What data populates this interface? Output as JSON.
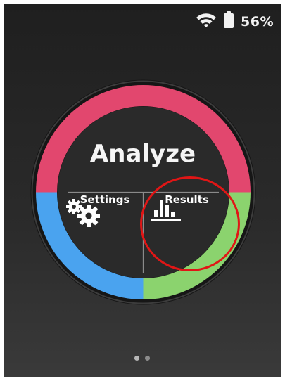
{
  "status_bar": {
    "wifi_icon": "wifi-icon",
    "battery_icon": "battery-icon",
    "battery_percent": "56%"
  },
  "dial": {
    "colors": {
      "top": "#e2476e",
      "left": "#4aa3ef",
      "right": "#8bd36e",
      "center": "#2a2a2a",
      "rim": "#1c1c1c"
    },
    "analyze_label": "Analyze",
    "settings": {
      "label": "Settings",
      "icon": "gears-icon"
    },
    "results": {
      "label": "Results",
      "icon": "bar-chart-icon"
    }
  },
  "highlight_color": "#e01616",
  "pager": {
    "pages": 2,
    "active_page": 1
  }
}
